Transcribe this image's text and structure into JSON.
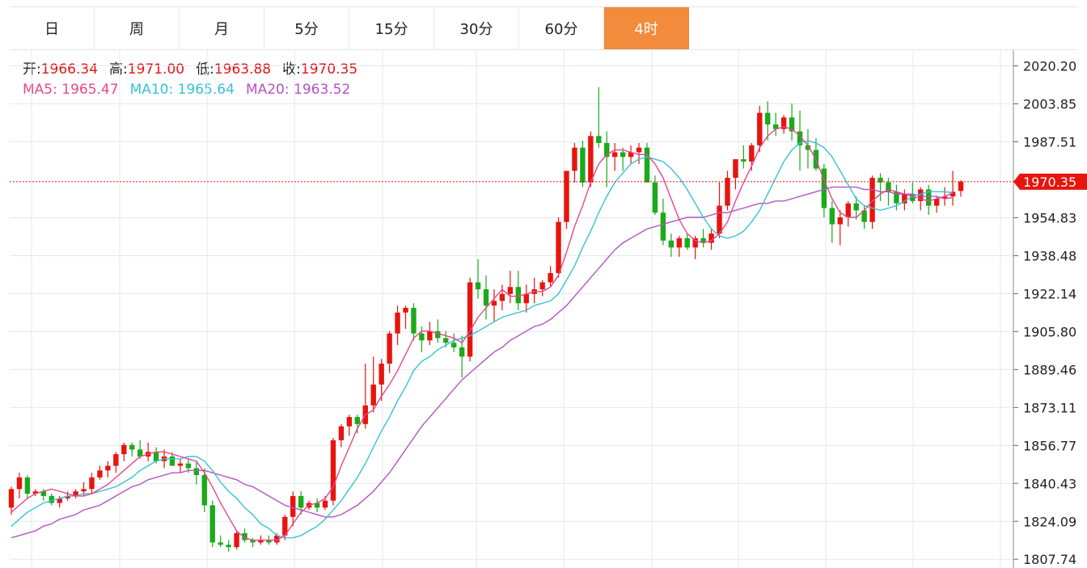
{
  "tabs": [
    {
      "label": "日",
      "active": false
    },
    {
      "label": "周",
      "active": false
    },
    {
      "label": "月",
      "active": false
    },
    {
      "label": "5分",
      "active": false
    },
    {
      "label": "15分",
      "active": false
    },
    {
      "label": "30分",
      "active": false
    },
    {
      "label": "60分",
      "active": false
    },
    {
      "label": "4时",
      "active": true
    }
  ],
  "ohlc_info": {
    "open_label": "开:",
    "open": "1966.34",
    "high_label": "高:",
    "high": "1971.00",
    "low_label": "低:",
    "low": "1963.88",
    "close_label": "收:",
    "close": "1970.35"
  },
  "ma_info": {
    "ma5_label": "MA5:",
    "ma5": "1965.47",
    "ma10_label": "MA10:",
    "ma10": "1965.64",
    "ma20_label": "MA20:",
    "ma20": "1963.52"
  },
  "colors": {
    "up": "#e8140e",
    "down": "#1aaa1a",
    "ma5": "#e8478b",
    "ma10": "#36c3d4",
    "ma20": "#b453c4",
    "price_line": "#e8140e",
    "active_tab": "#f28b3c",
    "grid": "#e3e8ef"
  },
  "chart_data": {
    "type": "candlestick",
    "y_ticks": [
      "2020.20",
      "2003.85",
      "1987.51",
      "1970.35",
      "1954.83",
      "1938.48",
      "1922.14",
      "1905.80",
      "1889.46",
      "1873.11",
      "1856.77",
      "1840.43",
      "1824.09",
      "1807.74"
    ],
    "ylim": [
      1804,
      2027
    ],
    "current_price": 1970.35,
    "grid": true,
    "candles": [
      [
        1830,
        1839,
        1827,
        1838
      ],
      [
        1838,
        1845,
        1834,
        1843
      ],
      [
        1843,
        1844,
        1834,
        1836
      ],
      [
        1836,
        1838,
        1835,
        1837
      ],
      [
        1837,
        1838,
        1833,
        1835
      ],
      [
        1835,
        1836,
        1831,
        1832
      ],
      [
        1832,
        1835,
        1830,
        1834
      ],
      [
        1834,
        1837,
        1833,
        1835
      ],
      [
        1835,
        1838,
        1834,
        1837
      ],
      [
        1837,
        1841,
        1835,
        1838
      ],
      [
        1838,
        1845,
        1836,
        1843
      ],
      [
        1843,
        1848,
        1842,
        1846
      ],
      [
        1846,
        1850,
        1843,
        1848
      ],
      [
        1848,
        1854,
        1845,
        1853
      ],
      [
        1853,
        1858,
        1850,
        1857
      ],
      [
        1857,
        1858,
        1852,
        1855
      ],
      [
        1855,
        1859,
        1851,
        1852
      ],
      [
        1852,
        1858,
        1850,
        1854
      ],
      [
        1854,
        1856,
        1849,
        1850
      ],
      [
        1850,
        1855,
        1847,
        1852
      ],
      [
        1852,
        1854,
        1849,
        1848
      ],
      [
        1848,
        1851,
        1845,
        1849
      ],
      [
        1849,
        1851,
        1845,
        1847
      ],
      [
        1847,
        1850,
        1840,
        1844
      ],
      [
        1844,
        1847,
        1828,
        1831
      ],
      [
        1831,
        1833,
        1813,
        1815
      ],
      [
        1815,
        1818,
        1813,
        1814
      ],
      [
        1814,
        1816,
        1811,
        1813
      ],
      [
        1813,
        1820,
        1812,
        1819
      ],
      [
        1819,
        1821,
        1815,
        1816
      ],
      [
        1816,
        1817,
        1813,
        1815
      ],
      [
        1815,
        1818,
        1814,
        1816
      ],
      [
        1816,
        1818,
        1814,
        1815
      ],
      [
        1815,
        1819,
        1814,
        1818
      ],
      [
        1818,
        1827,
        1816,
        1826
      ],
      [
        1826,
        1837,
        1822,
        1835
      ],
      [
        1835,
        1837,
        1827,
        1830
      ],
      [
        1830,
        1833,
        1829,
        1832
      ],
      [
        1832,
        1834,
        1828,
        1830
      ],
      [
        1830,
        1835,
        1829,
        1833
      ],
      [
        1833,
        1860,
        1831,
        1859
      ],
      [
        1859,
        1866,
        1856,
        1865
      ],
      [
        1865,
        1870,
        1861,
        1869
      ],
      [
        1869,
        1870,
        1862,
        1866
      ],
      [
        1866,
        1892,
        1864,
        1874
      ],
      [
        1874,
        1895,
        1871,
        1883
      ],
      [
        1883,
        1894,
        1876,
        1892
      ],
      [
        1892,
        1906,
        1888,
        1905
      ],
      [
        1905,
        1917,
        1900,
        1914
      ],
      [
        1914,
        1917,
        1907,
        1916
      ],
      [
        1916,
        1918,
        1902,
        1905
      ],
      [
        1905,
        1908,
        1897,
        1902
      ],
      [
        1902,
        1910,
        1900,
        1906
      ],
      [
        1906,
        1911,
        1901,
        1903
      ],
      [
        1903,
        1906,
        1899,
        1901
      ],
      [
        1901,
        1905,
        1897,
        1899
      ],
      [
        1899,
        1904,
        1886,
        1895
      ],
      [
        1895,
        1929,
        1893,
        1927
      ],
      [
        1927,
        1937,
        1920,
        1924
      ],
      [
        1924,
        1930,
        1911,
        1917
      ],
      [
        1917,
        1924,
        1910,
        1919
      ],
      [
        1919,
        1926,
        1915,
        1922
      ],
      [
        1922,
        1932,
        1918,
        1925
      ],
      [
        1925,
        1932,
        1915,
        1918
      ],
      [
        1918,
        1926,
        1914,
        1922
      ],
      [
        1922,
        1929,
        1918,
        1924
      ],
      [
        1924,
        1928,
        1921,
        1927
      ],
      [
        1927,
        1934,
        1925,
        1931
      ],
      [
        1931,
        1955,
        1929,
        1953
      ],
      [
        1953,
        1975,
        1950,
        1975
      ],
      [
        1975,
        1987,
        1970,
        1985
      ],
      [
        1985,
        1988,
        1968,
        1970
      ],
      [
        1970,
        1992,
        1968,
        1990
      ],
      [
        1990,
        2011,
        1985,
        1987
      ],
      [
        1987,
        1992,
        1968,
        1981
      ],
      [
        1981,
        1987,
        1975,
        1983
      ],
      [
        1983,
        1985,
        1975,
        1981
      ],
      [
        1981,
        1986,
        1978,
        1983
      ],
      [
        1983,
        1987,
        1978,
        1985
      ],
      [
        1985,
        1987,
        1972,
        1970
      ],
      [
        1970,
        1973,
        1956,
        1957
      ],
      [
        1957,
        1963,
        1943,
        1945
      ],
      [
        1945,
        1948,
        1938,
        1942
      ],
      [
        1942,
        1947,
        1938,
        1946
      ],
      [
        1946,
        1948,
        1941,
        1942
      ],
      [
        1942,
        1947,
        1937,
        1946
      ],
      [
        1946,
        1950,
        1942,
        1944
      ],
      [
        1944,
        1950,
        1941,
        1948
      ],
      [
        1948,
        1970,
        1946,
        1960
      ],
      [
        1960,
        1975,
        1958,
        1972
      ],
      [
        1972,
        1980,
        1967,
        1980
      ],
      [
        1980,
        1986,
        1976,
        1979
      ],
      [
        1979,
        1987,
        1975,
        1986
      ],
      [
        1986,
        2003,
        1983,
        2000
      ],
      [
        2000,
        2005,
        1988,
        1995
      ],
      [
        1995,
        2000,
        1990,
        1993
      ],
      [
        1993,
        1999,
        1991,
        1998
      ],
      [
        1998,
        2004,
        1988,
        1992
      ],
      [
        1992,
        2001,
        1975,
        1986
      ],
      [
        1986,
        1993,
        1976,
        1984
      ],
      [
        1984,
        1989,
        1975,
        1976
      ],
      [
        1976,
        1978,
        1955,
        1959
      ],
      [
        1959,
        1962,
        1944,
        1952
      ],
      [
        1952,
        1958,
        1943,
        1955
      ],
      [
        1955,
        1962,
        1951,
        1961
      ],
      [
        1961,
        1964,
        1954,
        1958
      ],
      [
        1958,
        1960,
        1950,
        1953
      ],
      [
        1953,
        1973,
        1950,
        1972
      ],
      [
        1972,
        1974,
        1962,
        1970
      ],
      [
        1970,
        1972,
        1960,
        1966
      ],
      [
        1966,
        1969,
        1958,
        1961
      ],
      [
        1961,
        1967,
        1958,
        1965
      ],
      [
        1965,
        1970,
        1961,
        1962
      ],
      [
        1962,
        1968,
        1958,
        1967
      ],
      [
        1967,
        1969,
        1956,
        1960
      ],
      [
        1960,
        1964,
        1957,
        1963
      ],
      [
        1963,
        1968,
        1960,
        1964
      ],
      [
        1964,
        1975,
        1960,
        1966
      ],
      [
        1966.34,
        1971,
        1963.88,
        1970.35
      ]
    ],
    "ma5": [
      1828,
      1831,
      1834,
      1836,
      1837,
      1838,
      1837,
      1836,
      1835,
      1835,
      1836,
      1838,
      1840,
      1843,
      1846,
      1849,
      1852,
      1853,
      1854,
      1854,
      1853,
      1852,
      1851,
      1850,
      1845,
      1839,
      1832,
      1826,
      1820,
      1817,
      1816,
      1816,
      1816,
      1816,
      1818,
      1823,
      1828,
      1831,
      1832,
      1834,
      1839,
      1848,
      1856,
      1864,
      1870,
      1872,
      1878,
      1883,
      1889,
      1896,
      1903,
      1906,
      1906,
      1905,
      1904,
      1903,
      1901,
      1906,
      1912,
      1916,
      1920,
      1924,
      1921,
      1921,
      1922,
      1923,
      1923,
      1925,
      1930,
      1940,
      1951,
      1960,
      1970,
      1978,
      1982,
      1984,
      1984,
      1983,
      1982,
      1982,
      1978,
      1972,
      1963,
      1954,
      1948,
      1945,
      1944,
      1945,
      1948,
      1953,
      1962,
      1970,
      1977,
      1985,
      1990,
      1993,
      1994,
      1993,
      1990,
      1986,
      1980,
      1971,
      1963,
      1957,
      1955,
      1955,
      1958,
      1962,
      1965,
      1967,
      1966,
      1965,
      1964,
      1963,
      1962,
      1963,
      1964,
      1965.5
    ],
    "ma10": [
      1822,
      1825,
      1828,
      1830,
      1832,
      1833,
      1834,
      1835,
      1835,
      1836,
      1836,
      1837,
      1838,
      1839,
      1841,
      1843,
      1846,
      1848,
      1850,
      1851,
      1851,
      1851,
      1852,
      1852,
      1850,
      1846,
      1841,
      1837,
      1834,
      1830,
      1827,
      1823,
      1821,
      1818,
      1817,
      1817,
      1818,
      1820,
      1822,
      1825,
      1829,
      1833,
      1838,
      1843,
      1849,
      1856,
      1863,
      1869,
      1876,
      1882,
      1889,
      1893,
      1895,
      1898,
      1900,
      1902,
      1903,
      1904,
      1906,
      1908,
      1910,
      1912,
      1913,
      1914,
      1915,
      1917,
      1918,
      1919,
      1922,
      1928,
      1934,
      1942,
      1949,
      1957,
      1964,
      1970,
      1974,
      1978,
      1980,
      1981,
      1980,
      1979,
      1976,
      1972,
      1967,
      1961,
      1955,
      1950,
      1947,
      1946,
      1947,
      1949,
      1953,
      1958,
      1965,
      1972,
      1979,
      1984,
      1987,
      1988,
      1987,
      1985,
      1981,
      1975,
      1969,
      1963,
      1960,
      1959,
      1958,
      1959,
      1960,
      1962,
      1964,
      1965,
      1966,
      1966,
      1966,
      1965.6
    ],
    "ma20": [
      1817,
      1818,
      1819,
      1820,
      1822,
      1823,
      1825,
      1826,
      1827,
      1829,
      1830,
      1831,
      1833,
      1835,
      1837,
      1839,
      1840,
      1842,
      1843,
      1844,
      1845,
      1845,
      1846,
      1846,
      1846,
      1845,
      1844,
      1843,
      1842,
      1840,
      1839,
      1837,
      1835,
      1833,
      1831,
      1830,
      1829,
      1828,
      1827,
      1826,
      1826,
      1827,
      1829,
      1831,
      1834,
      1837,
      1841,
      1845,
      1850,
      1855,
      1860,
      1865,
      1869,
      1873,
      1877,
      1881,
      1885,
      1888,
      1891,
      1894,
      1897,
      1899,
      1902,
      1904,
      1906,
      1908,
      1909,
      1911,
      1914,
      1917,
      1921,
      1925,
      1929,
      1933,
      1937,
      1941,
      1944,
      1946,
      1948,
      1950,
      1951,
      1952,
      1953,
      1954,
      1955,
      1955,
      1955,
      1956,
      1957,
      1957,
      1958,
      1959,
      1960,
      1961,
      1961,
      1962,
      1962,
      1963,
      1964,
      1965,
      1966,
      1967,
      1968,
      1968,
      1968,
      1968,
      1967,
      1967,
      1966,
      1966,
      1965,
      1965,
      1965,
      1964,
      1964,
      1964,
      1963,
      1963.5
    ]
  }
}
